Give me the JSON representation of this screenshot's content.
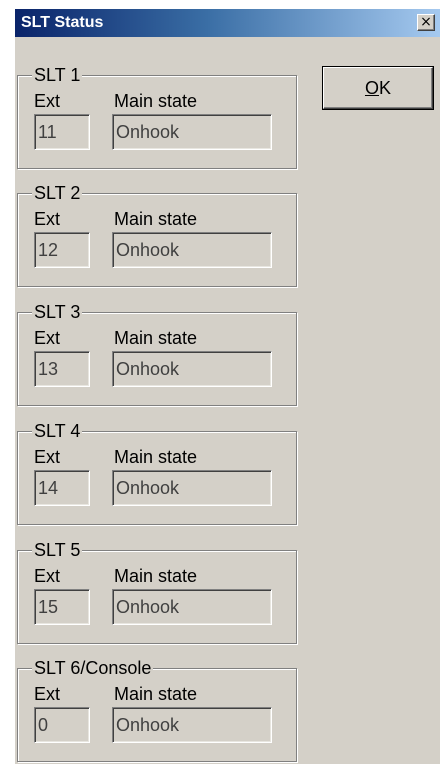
{
  "window": {
    "title": "SLT Status",
    "close_glyph": "×"
  },
  "buttons": {
    "ok_label": "OK"
  },
  "groups": [
    {
      "title": "SLT 1",
      "ext_label": "Ext",
      "main_label": "Main state",
      "ext": "11",
      "state": "Onhook"
    },
    {
      "title": "SLT 2",
      "ext_label": "Ext",
      "main_label": "Main state",
      "ext": "12",
      "state": "Onhook"
    },
    {
      "title": "SLT 3",
      "ext_label": "Ext",
      "main_label": "Main state",
      "ext": "13",
      "state": "Onhook"
    },
    {
      "title": "SLT 4",
      "ext_label": "Ext",
      "main_label": "Main state",
      "ext": "14",
      "state": "Onhook"
    },
    {
      "title": "SLT 5",
      "ext_label": "Ext",
      "main_label": "Main state",
      "ext": "15",
      "state": "Onhook"
    },
    {
      "title": "SLT 6/Console",
      "ext_label": "Ext",
      "main_label": "Main state",
      "ext": "0",
      "state": "Onhook"
    }
  ]
}
